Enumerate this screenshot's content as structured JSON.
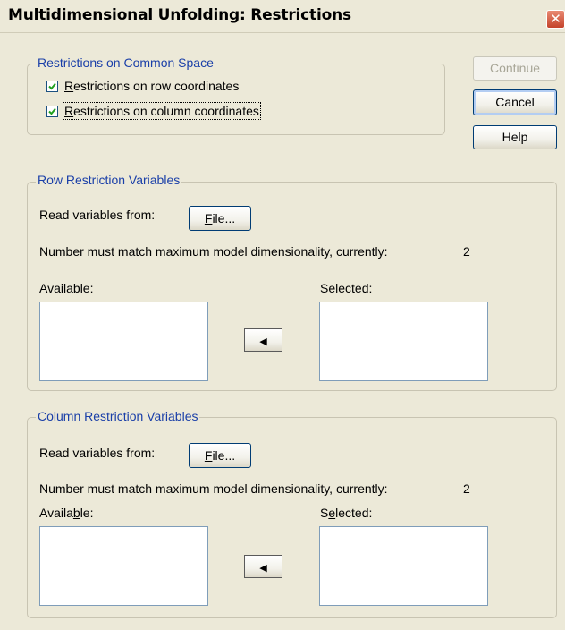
{
  "window": {
    "title": "Multidimensional Unfolding: Restrictions",
    "close_glyph": "✕"
  },
  "common_space": {
    "legend": "Restrictions on Common Space",
    "row_checkbox": {
      "label": "Restrictions on row coordinates",
      "checked": true
    },
    "column_checkbox": {
      "label": "Restrictions on column coordinates",
      "checked": true
    }
  },
  "buttons": {
    "continue": "Continue",
    "cancel": "Cancel",
    "help": "Help"
  },
  "row_restriction": {
    "legend": "Row Restriction Variables",
    "read_label": "Read variables from:",
    "file_button": "File...",
    "dimensionality_text": "Number must match maximum model dimensionality, currently:",
    "dimensionality_value": "2",
    "available_label": "Available:",
    "selected_label": "Selected:",
    "arrow_glyph": "◀"
  },
  "column_restriction": {
    "legend": "Column Restriction Variables",
    "read_label": "Read variables from:",
    "file_button": "File...",
    "dimensionality_text": "Number must match maximum model dimensionality, currently:",
    "dimensionality_value": "2",
    "available_label": "Available:",
    "selected_label": "Selected:",
    "arrow_glyph": "◀"
  },
  "colors": {
    "dialog_bg": "#ece9d8",
    "legend_text": "#1a3fa8",
    "close_button": "#c4432b"
  }
}
